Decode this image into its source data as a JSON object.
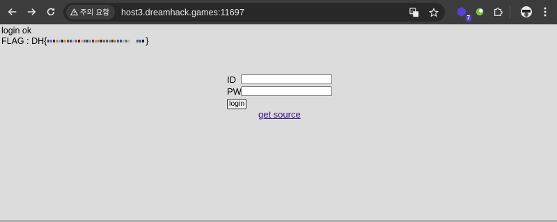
{
  "browser": {
    "security_chip_label": "주의 요함",
    "url": "host3.dreamhack.games:11697",
    "extension_badge": "7",
    "icons": [
      "back-icon",
      "forward-icon",
      "reload-icon",
      "warning-icon",
      "translate-icon",
      "star-icon",
      "extension-icon",
      "puzzle-icon",
      "avatar-icon",
      "menu-icon"
    ]
  },
  "page": {
    "status": "login ok",
    "flag_label": "FLAG : DH{",
    "flag_close": "}",
    "form": {
      "id_label": "ID",
      "pw_label": "PW",
      "login_button": "login",
      "id_value": "",
      "pw_value": ""
    },
    "source_link": "get source"
  },
  "colors": {
    "toolbar": "#3c3c3c",
    "omnibox": "#282828",
    "page_bg": "#dcdcdc",
    "link": "#2d1080"
  }
}
